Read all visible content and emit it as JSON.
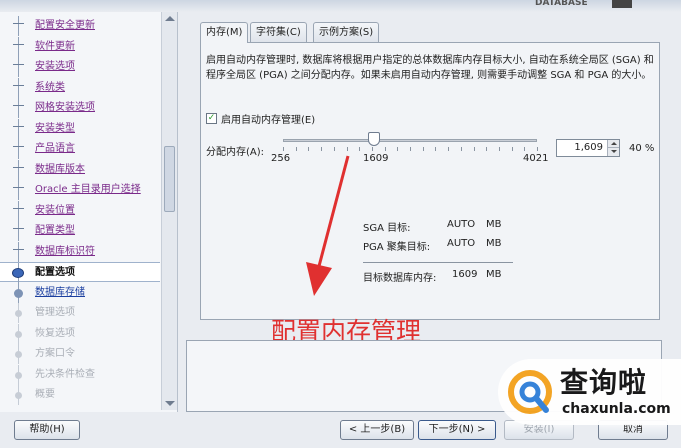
{
  "header": {
    "logo_text": "DATABASE"
  },
  "steps": [
    {
      "label": "配置安全更新",
      "state": "done"
    },
    {
      "label": "软件更新",
      "state": "done"
    },
    {
      "label": "安装选项",
      "state": "done"
    },
    {
      "label": "系统类",
      "state": "done"
    },
    {
      "label": "网格安装选项",
      "state": "done"
    },
    {
      "label": "安装类型",
      "state": "done"
    },
    {
      "label": "产品语言",
      "state": "done"
    },
    {
      "label": "数据库版本",
      "state": "done"
    },
    {
      "label": "Oracle 主目录用户选择",
      "state": "done"
    },
    {
      "label": "安装位置",
      "state": "done"
    },
    {
      "label": "配置类型",
      "state": "done"
    },
    {
      "label": "数据库标识符",
      "state": "done"
    },
    {
      "label": "配置选项",
      "state": "current"
    },
    {
      "label": "数据库存储",
      "state": "next"
    },
    {
      "label": "管理选项",
      "state": "future"
    },
    {
      "label": "恢复选项",
      "state": "future"
    },
    {
      "label": "方案口令",
      "state": "future"
    },
    {
      "label": "先决条件检查",
      "state": "future"
    },
    {
      "label": "概要",
      "state": "future"
    }
  ],
  "tabs": [
    {
      "label": "内存(M)"
    },
    {
      "label": "字符集(C)"
    },
    {
      "label": "示例方案(S)"
    }
  ],
  "memory": {
    "description": "启用自动内存管理时, 数据库将根据用户指定的总体数据库内存目标大小, 自动在系统全局区 (SGA) 和程序全局区 (PGA) 之间分配内存。如果未启用自动内存管理, 则需要手动调整 SGA 和 PGA 的大小。",
    "checkbox_label": "启用自动内存管理(E)",
    "checkbox_checked": true,
    "alloc_label": "分配内存(A):",
    "slider_min": "256",
    "slider_mid": "1609",
    "slider_max": "4021",
    "slider_value": 1609,
    "spin_value": "1,609",
    "percent": "40 %",
    "sga_label": "SGA 目标:",
    "sga_value": "AUTO",
    "sga_unit": "MB",
    "pga_label": "PGA 聚集目标:",
    "pga_value": "AUTO",
    "pga_unit": "MB",
    "target_label": "目标数据库内存:",
    "target_value": "1609",
    "target_unit": "MB"
  },
  "annotation": {
    "text": "配置内存管理",
    "color": "#e03030"
  },
  "buttons": {
    "help": "帮助(H)",
    "back": "< 上一步(B)",
    "next": "下一步(N) >",
    "install": "安装(I)",
    "cancel": "取消"
  },
  "watermark": {
    "cn": "查询啦",
    "en": "chaxunla.com"
  },
  "colors": {
    "accent_blue": "#3b67b8",
    "link_purple": "#7a2a8a",
    "annotation_red": "#e03030"
  }
}
